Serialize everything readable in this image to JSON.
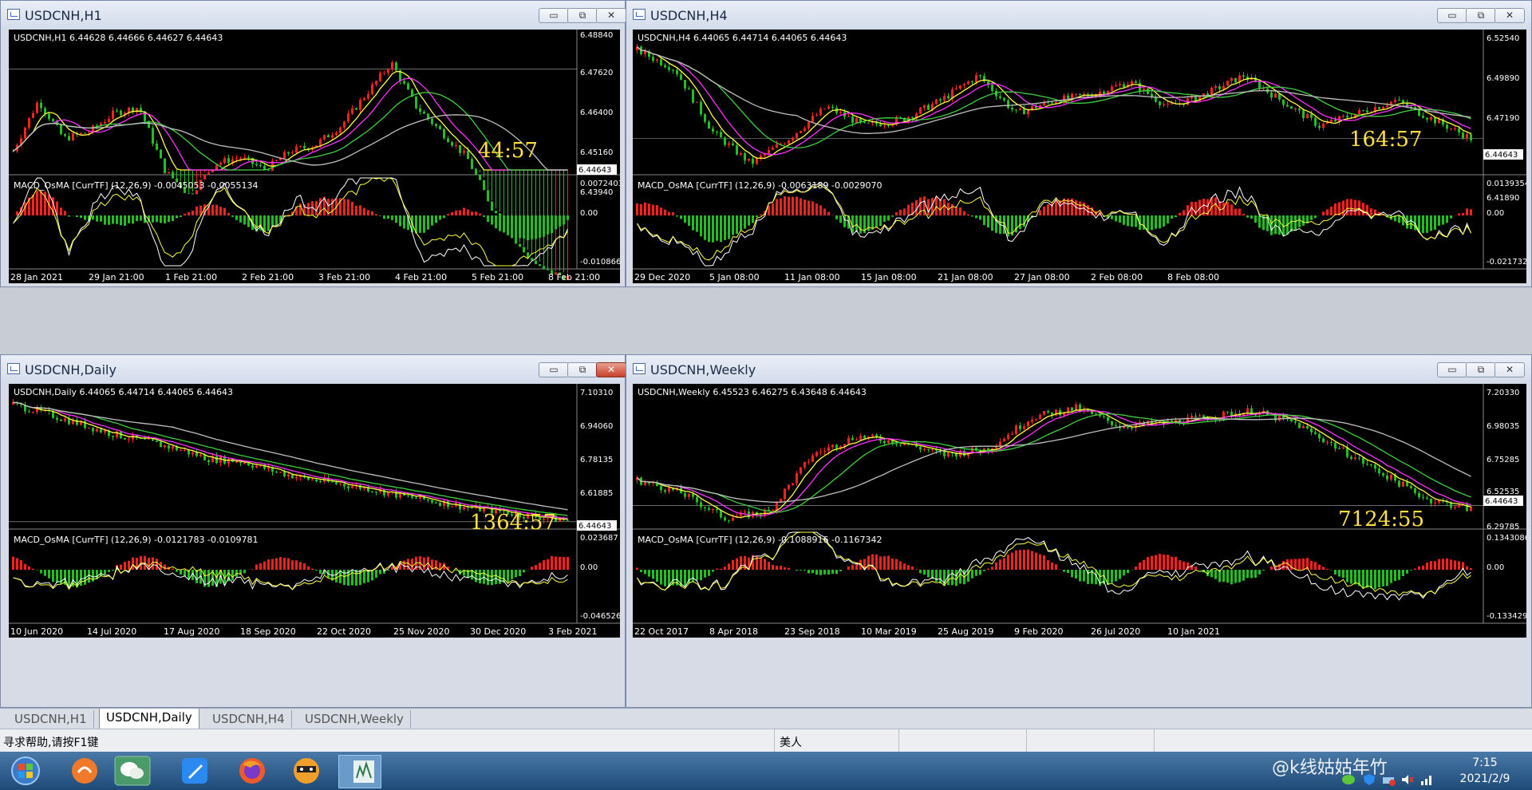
{
  "windows": [
    {
      "id": "h1",
      "title": "USDCNH,H1",
      "header": "USDCNH,H1  6.44628 6.44666 6.44627 6.44643",
      "prices": [
        "6.48840",
        "6.47620",
        "6.46400",
        "6.45160",
        "6.43940"
      ],
      "current_price": "6.44643",
      "countdown": "44:57",
      "macd_header": "MACD_OsMA [CurrTF] (12,26,9) -0.0045053 -0.0055134",
      "macd_levels": [
        "0.0072403",
        "0.00",
        "-0.0108666"
      ],
      "dates": [
        "28 Jan 2021",
        "29 Jan 21:00",
        "1 Feb 21:00",
        "2 Feb 21:00",
        "3 Feb 21:00",
        "4 Feb 21:00",
        "5 Feb 21:00",
        "8 Feb 21:00"
      ]
    },
    {
      "id": "h4",
      "title": "USDCNH,H4",
      "header": "USDCNH,H4  6.44065 6.44714 6.44065 6.44643",
      "prices": [
        "6.52540",
        "6.49890",
        "6.47190",
        "6.44643",
        "6.41890"
      ],
      "current_price": "6.44643",
      "countdown": "164:57",
      "macd_header": "MACD_OsMA [CurrTF] (12,26,9) -0.0063189 -0.0029070",
      "macd_levels": [
        "0.0139354",
        "0.00",
        "-0.0217328"
      ],
      "dates": [
        "29 Dec 2020",
        "5 Jan 08:00",
        "11 Jan 08:00",
        "15 Jan 08:00",
        "21 Jan 08:00",
        "27 Jan 08:00",
        "2 Feb 08:00",
        "8 Feb 08:00"
      ]
    },
    {
      "id": "daily",
      "title": "USDCNH,Daily",
      "header": "USDCNH,Daily  6.44065 6.44714 6.44065 6.44643",
      "prices": [
        "7.10310",
        "6.94060",
        "6.78135",
        "6.61885",
        "6.44643"
      ],
      "current_price": "6.44643",
      "countdown": "1364:57",
      "macd_header": "MACD_OsMA [CurrTF] (12,26,9) -0.0121783 -0.0109781",
      "macd_levels": [
        "0.023687",
        "0.00",
        "-0.046526"
      ],
      "dates": [
        "10 Jun 2020",
        "14 Jul 2020",
        "17 Aug 2020",
        "18 Sep 2020",
        "22 Oct 2020",
        "25 Nov 2020",
        "30 Dec 2020",
        "3 Feb 2021"
      ]
    },
    {
      "id": "weekly",
      "title": "USDCNH,Weekly",
      "header": "USDCNH,Weekly  6.45523 6.46275 6.43648 6.44643",
      "prices": [
        "7.20330",
        "6.98035",
        "6.75285",
        "6.52535",
        "6.29785"
      ],
      "current_price": "6.44643",
      "countdown": "7124:55",
      "macd_header": "MACD_OsMA [CurrTF] (12,26,9) -0.1088916 -0.1167342",
      "macd_levels": [
        "0.1343086",
        "0.00",
        "-0.1334299"
      ],
      "dates": [
        "22 Oct 2017",
        "8 Apr 2018",
        "23 Sep 2018",
        "10 Mar 2019",
        "25 Aug 2019",
        "9 Feb 2020",
        "26 Jul 2020",
        "10 Jan 2021"
      ]
    }
  ],
  "window_buttons": {
    "minimize": "▭",
    "maximize": "⧉",
    "close": "✕"
  },
  "tabs": [
    "USDCNH,H1",
    "USDCNH,Daily",
    "USDCNH,H4",
    "USDCNH,Weekly"
  ],
  "active_tab": "USDCNH,Daily",
  "status": {
    "help": "寻求帮助,请按F1键",
    "profile": "美人"
  },
  "clock": {
    "time": "7:15",
    "date": "2021/2/9"
  },
  "watermark": "@k线姑姑年竹",
  "colors": {
    "bull": "#ff2020",
    "bear": "#20c020",
    "ma_fast": "#ffff40",
    "ma_mid": "#ff30ff",
    "ma_slow": "#40d040",
    "ma_long": "#c0c0c0",
    "countdown": "#ffe040"
  },
  "taskbar_icons": [
    "start-orb",
    "app-orange",
    "wechat",
    "feishu",
    "firefox",
    "app-mascot",
    "metatrader"
  ]
}
